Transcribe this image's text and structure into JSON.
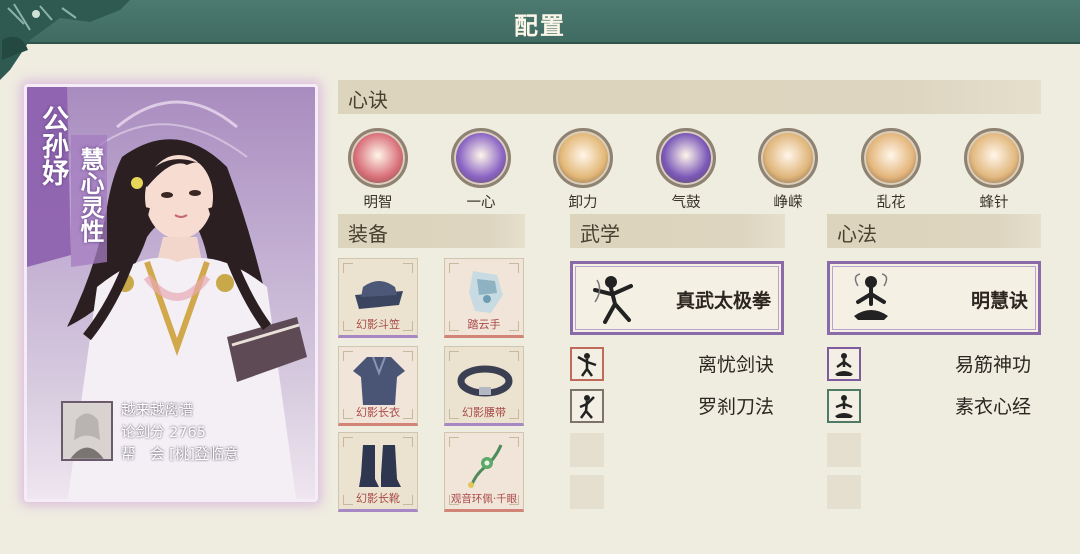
{
  "header": {
    "title": "配置"
  },
  "character": {
    "name": "公孙妤",
    "title": "慧心灵性",
    "player": {
      "name": "越来越离谱",
      "score_label": "论剑分",
      "score_value": "2765",
      "guild_label": "帮　会",
      "guild_value": "[桃]登临意"
    }
  },
  "xinjue": {
    "title": "心诀",
    "items": [
      {
        "label": "明智",
        "icon": "mingzhi-swirl-icon",
        "color": "#d9707a"
      },
      {
        "label": "一心",
        "icon": "yixin-flame-icon",
        "color": "#8a64c4"
      },
      {
        "label": "卸力",
        "icon": "xieli-swirl-icon",
        "color": "#e3b878"
      },
      {
        "label": "气鼓",
        "icon": "qigu-orb-icon",
        "color": "#7a58b8"
      },
      {
        "label": "峥嵘",
        "icon": "zhengrong-cloud-icon",
        "color": "#e0b57a"
      },
      {
        "label": "乱花",
        "icon": "luanhua-flower-icon",
        "color": "#e4b67c"
      },
      {
        "label": "蜂针",
        "icon": "fengzhen-bee-icon",
        "color": "#e2b87e"
      }
    ]
  },
  "equipment": {
    "title": "装备",
    "items": [
      {
        "label": "幻影斗笠",
        "icon": "hat-icon",
        "rarity": "purple"
      },
      {
        "label": "踏云手",
        "icon": "glove-icon",
        "rarity": "red"
      },
      {
        "label": "幻影长衣",
        "icon": "robe-icon",
        "rarity": "red"
      },
      {
        "label": "幻影腰带",
        "icon": "belt-icon",
        "rarity": "purple"
      },
      {
        "label": "幻影长靴",
        "icon": "boots-icon",
        "rarity": "purple"
      },
      {
        "label": "观音环佩·千眼",
        "icon": "pendant-icon",
        "rarity": "red"
      }
    ]
  },
  "wuxue": {
    "title": "武学",
    "main": "真武太极拳",
    "subs": [
      {
        "label": "离忧剑诀",
        "frame": "red"
      },
      {
        "label": "罗刹刀法",
        "frame": "gray"
      }
    ]
  },
  "xinfa": {
    "title": "心法",
    "main": "明慧诀",
    "subs": [
      {
        "label": "易筋神功",
        "frame": "purple"
      },
      {
        "label": "素衣心经",
        "frame": "green"
      }
    ]
  }
}
